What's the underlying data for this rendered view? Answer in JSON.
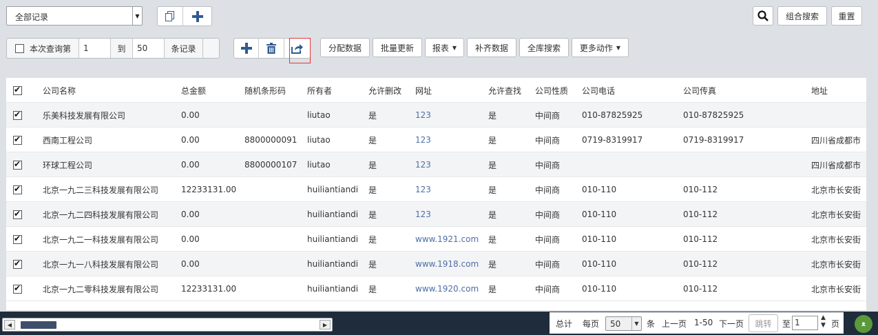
{
  "top": {
    "record_select": "全部记录",
    "combined_search": "组合搜索",
    "reset": "重置"
  },
  "range": {
    "label_prefix": "本次查询第",
    "from": "1",
    "to_label": "到",
    "to": "50",
    "suffix": "条记录"
  },
  "toolbar": {
    "assign": "分配数据",
    "batch_update": "批量更新",
    "report": "报表",
    "complete": "补齐数据",
    "full_search": "全库搜索",
    "more": "更多动作"
  },
  "table": {
    "headers": [
      "公司名称",
      "总金额",
      "随机条形码",
      "所有者",
      "允许删改",
      "网址",
      "允许查找",
      "公司性质",
      "公司电话",
      "公司传真",
      "地址"
    ],
    "rows": [
      [
        "乐美科技发展有限公司",
        "0.00",
        "",
        "liutao",
        "是",
        "123",
        "是",
        "中间商",
        "010-87825925",
        "010-87825925",
        ""
      ],
      [
        "西南工程公司",
        "0.00",
        "8800000091",
        "liutao",
        "是",
        "123",
        "是",
        "中间商",
        "0719-8319917",
        "0719-8319917",
        "四川省成都市"
      ],
      [
        "环球工程公司",
        "0.00",
        "8800000107",
        "liutao",
        "是",
        "123",
        "是",
        "中间商",
        "",
        "",
        "四川省成都市"
      ],
      [
        "北京一九二三科技发展有限公司",
        "12233131.00",
        "",
        "huiliantiandi",
        "是",
        "123",
        "是",
        "中间商",
        "010-110",
        "010-112",
        "北京市长安街"
      ],
      [
        "北京一九二四科技发展有限公司",
        "0.00",
        "",
        "huiliantiandi",
        "是",
        "123",
        "是",
        "中间商",
        "010-110",
        "010-112",
        "北京市长安街"
      ],
      [
        "北京一九二一科技发展有限公司",
        "0.00",
        "",
        "huiliantiandi",
        "是",
        "www.1921.com",
        "是",
        "中间商",
        "010-110",
        "010-112",
        "北京市长安街"
      ],
      [
        "北京一九一八科技发展有限公司",
        "0.00",
        "",
        "huiliantiandi",
        "是",
        "www.1918.com",
        "是",
        "中间商",
        "010-110",
        "010-112",
        "北京市长安街"
      ],
      [
        "北京一九二零科技发展有限公司",
        "12233131.00",
        "",
        "huiliantiandi",
        "是",
        "www.1920.com",
        "是",
        "中间商",
        "010-110",
        "010-112",
        "北京市长安街"
      ]
    ]
  },
  "pager": {
    "total": "总计",
    "per_page": "每页",
    "per_page_value": "50",
    "unit": "条",
    "prev": "上一页",
    "range": "1-50",
    "next": "下一页",
    "jump": "跳转",
    "to": "至",
    "page_value": "1",
    "page_unit": "页"
  },
  "colors": {
    "link": "#4d6ea8",
    "footer": "#1f2c3b",
    "highlight": "#e03a3a"
  }
}
